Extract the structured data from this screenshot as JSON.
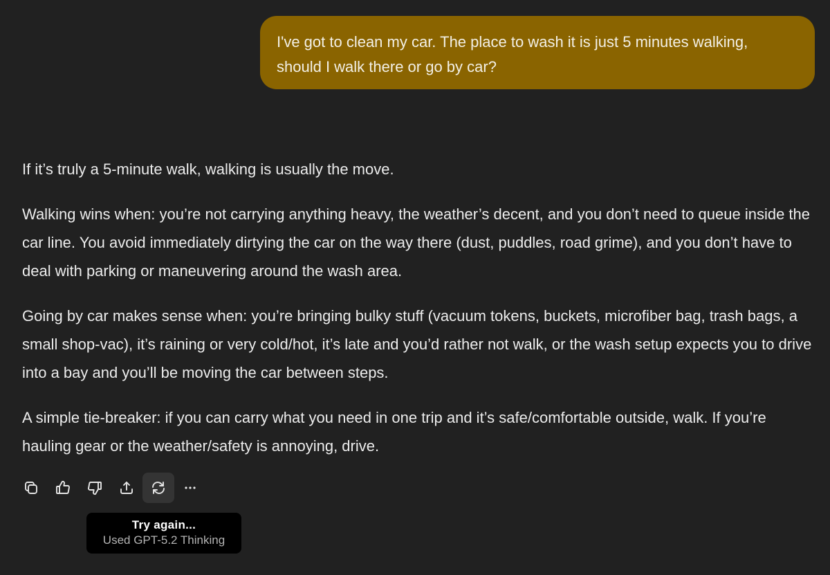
{
  "user_message": {
    "line1": "I've got to clean my car. The place to wash it is just 5 minutes walking,",
    "line2": "should I walk there or go by car?"
  },
  "assistant_message": {
    "paragraphs": [
      "If it’s truly a 5-minute walk, walking is usually the move.",
      "Walking wins when: you’re not carrying anything heavy, the weather’s decent, and you don’t need to queue inside the car line. You avoid immediately dirtying the car on the way there (dust, puddles, road grime), and you don’t have to deal with parking or maneuvering around the wash area.",
      "Going by car makes sense when: you’re bringing bulky stuff (vacuum tokens, buckets, microfiber bag, trash bags, a small shop-vac), it’s raining or very cold/hot, it’s late and you’d rather not walk, or the wash setup expects you to drive into a bay and you’ll be moving the car between steps.",
      "A simple tie-breaker: if you can carry what you need in one trip and it’s safe/comfortable outside, walk. If you’re hauling gear or the weather/safety is annoying, drive."
    ]
  },
  "actions": {
    "copy_icon": "copy-icon",
    "thumbs_up_icon": "thumbs-up-icon",
    "thumbs_down_icon": "thumbs-down-icon",
    "share_icon": "share-icon",
    "regenerate_icon": "regenerate-icon",
    "more_icon": "more-icon",
    "more_glyph": "•••"
  },
  "tooltip": {
    "title": "Try again...",
    "subtitle": "Used GPT-5.2 Thinking"
  },
  "colors": {
    "background": "#212121",
    "user_bubble": "#8a6400",
    "text": "#ececec",
    "tooltip_bg": "#000000"
  }
}
